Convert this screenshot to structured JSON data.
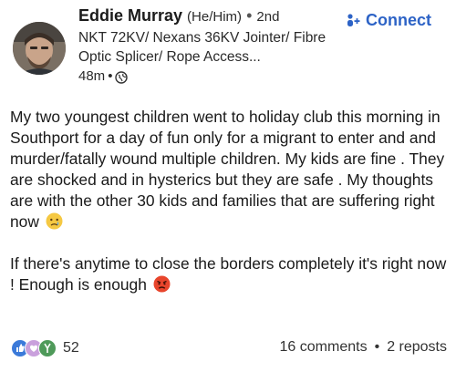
{
  "author": {
    "name": "Eddie Murray",
    "pronouns": "(He/Him)",
    "separator": "•",
    "degree": "2nd",
    "headline": "NKT 72KV/ Nexans 36KV Jointer/ Fibre Optic Splicer/ Rope Access...",
    "time": "48m",
    "time_separator": "•",
    "visibility_icon": "globe-icon"
  },
  "connect": {
    "label": "Connect",
    "icon": "add-person-icon",
    "color": "#2d63c6"
  },
  "post": {
    "paragraph1": "My two youngest children went to holiday club this morning in Southport  for a day of fun only for a migrant to enter and and murder/fatally wound multiple children. My kids are fine . They are shocked and in hysterics but they are safe . My thoughts are with the other 30 kids and families that are suffering right now",
    "paragraph1_emoji": "crying-face-emoji",
    "paragraph2": "If there's anytime to close the borders completely it's right now !  Enough is enough",
    "paragraph2_emoji": "angry-face-emoji"
  },
  "footer": {
    "reaction_icons": [
      "like-icon",
      "support-icon",
      "celebrate-icon"
    ],
    "reaction_count": "52",
    "comments": "16 comments",
    "separator": "•",
    "reposts": "2 reposts"
  }
}
